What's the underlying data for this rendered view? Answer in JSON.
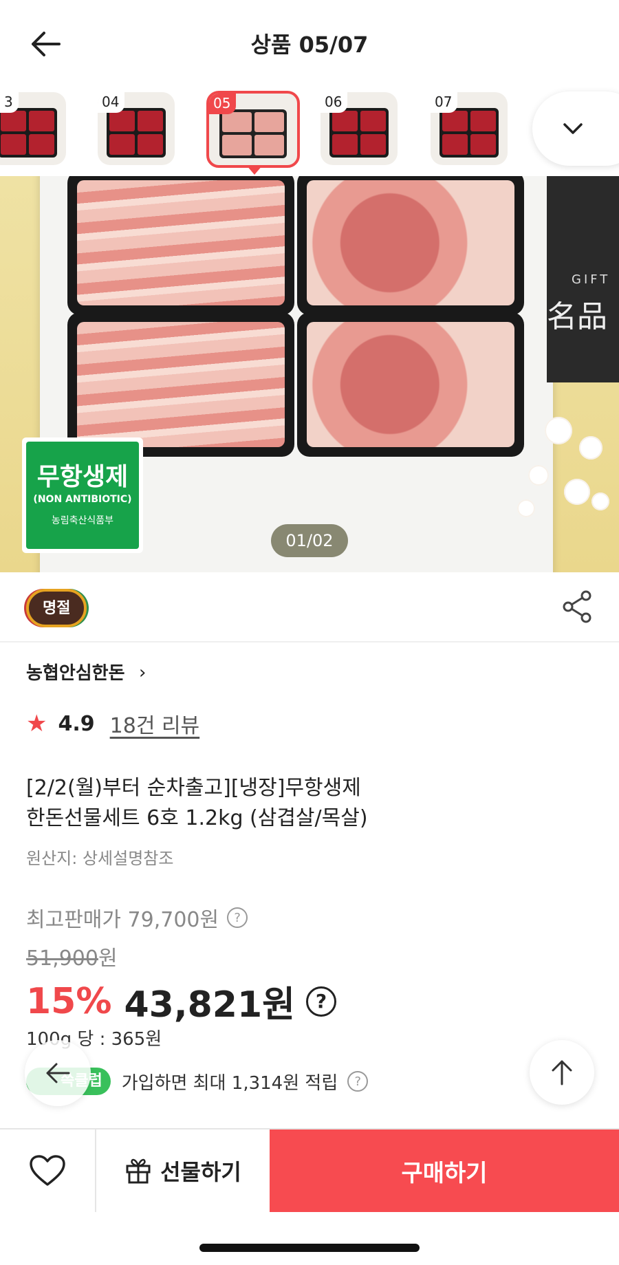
{
  "header": {
    "title": "상품 05/07"
  },
  "thumbnails": [
    {
      "num": "3"
    },
    {
      "num": "04"
    },
    {
      "num": "05"
    },
    {
      "num": "06"
    },
    {
      "num": "07"
    }
  ],
  "hero": {
    "pager": "01/02",
    "cert_main": "무항생제",
    "cert_sub": "(NON ANTIBIOTIC)",
    "cert_org": "농림축산식품부",
    "gift_text": "GIFT",
    "hanja_text": "名品"
  },
  "badge": {
    "label": "명절"
  },
  "product": {
    "brand": "농협안심한돈",
    "rating": "4.9",
    "reviews": "18건 리뷰",
    "title_line1": "[2/2(월)부터 순차출고][냉장]무항생제",
    "title_line2": "한돈선물세트 6호 1.2kg (삼겹살/목살)",
    "origin": "원산지: 상세설명참조"
  },
  "pricing": {
    "max_price": "최고판매가 79,700원",
    "original_price": "51,900",
    "original_unit": "원",
    "discount": "15%",
    "price": "43,821원",
    "unit_price": "100g 당 : 365원",
    "points_badge": "쓱클럽",
    "points_text": "가입하면 최대 1,314원 적립"
  },
  "actions": {
    "gift_label": "선물하기",
    "buy_label": "구매하기"
  },
  "colors": {
    "accent": "#f0484b",
    "buy": "#f74b50",
    "points_green": "#39c05b"
  }
}
